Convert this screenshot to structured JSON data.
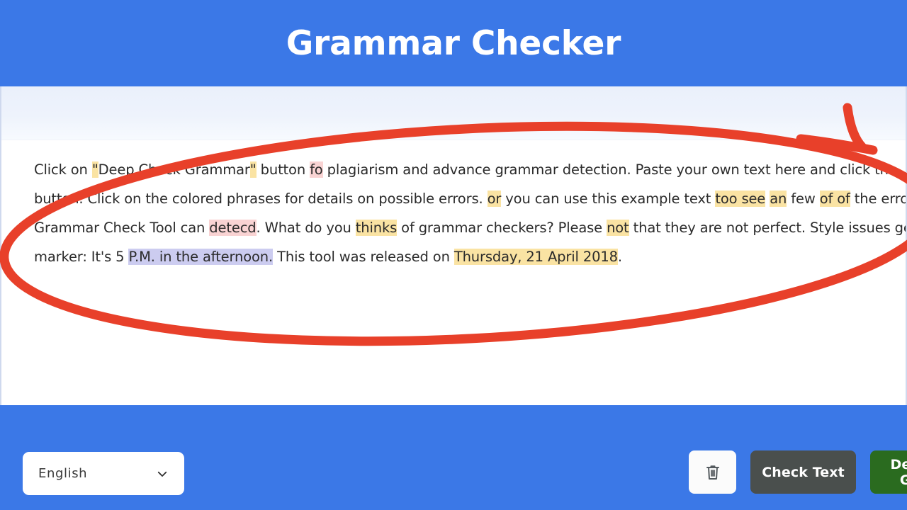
{
  "header": {
    "title": "Grammar Checker"
  },
  "editor": {
    "lines": [
      [
        {
          "text": "Click on ",
          "hl": "none"
        },
        {
          "text": "\"",
          "hl": "yellow"
        },
        {
          "text": "Deep Check Grammar",
          "hl": "none"
        },
        {
          "text": "\"",
          "hl": "yellow"
        },
        {
          "text": " button ",
          "hl": "none"
        },
        {
          "text": "fo",
          "hl": "red"
        },
        {
          "text": " plagiarism and advance grammar detection. Paste your own text here and click the",
          "hl": "none"
        }
      ],
      [
        {
          "text": "button. Click on the colored phrases for details on possible errors. ",
          "hl": "none"
        },
        {
          "text": "or",
          "hl": "yellow"
        },
        {
          "text": " you can use this example text ",
          "hl": "none"
        },
        {
          "text": "too see",
          "hl": "yellow"
        },
        {
          "text": " ",
          "hl": "none"
        },
        {
          "text": "an",
          "hl": "yellow"
        },
        {
          "text": " few ",
          "hl": "none"
        },
        {
          "text": "of of",
          "hl": "yellow"
        },
        {
          "text": " the errors that this",
          "hl": "none"
        }
      ],
      [
        {
          "text": "Grammar Check Tool can ",
          "hl": "none"
        },
        {
          "text": "detecd",
          "hl": "red"
        },
        {
          "text": ". What do you ",
          "hl": "none"
        },
        {
          "text": "thinks",
          "hl": "yellow"
        },
        {
          "text": " of grammar checkers? Please ",
          "hl": "none"
        },
        {
          "text": "not",
          "hl": "yellow"
        },
        {
          "text": " that they are not perfect. Style issues get a blue",
          "hl": "none"
        }
      ],
      [
        {
          "text": "marker: It's 5 ",
          "hl": "none"
        },
        {
          "text": "P.M. in the afternoon.",
          "hl": "purple"
        },
        {
          "text": " This tool was released on ",
          "hl": "none"
        },
        {
          "text": "Thursday, 21 April 2018",
          "hl": "yellow"
        },
        {
          "text": ".",
          "hl": "none"
        }
      ]
    ]
  },
  "footer": {
    "language": {
      "value": "English",
      "chevron_icon": "chevron-down-icon"
    },
    "clear_button": {
      "label": "",
      "icon": "trash-icon"
    },
    "check_button": {
      "label": "Check Text"
    },
    "deep_check_button": {
      "label": "Deep Check Grammar"
    }
  },
  "annotation": {
    "shape": "ellipse-with-arrow",
    "color": "#e8402a"
  },
  "colors": {
    "brand_blue": "#3b78e7",
    "toolbar_blue_gray": "#eaf0fb",
    "highlight_yellow": "#fae3a3",
    "highlight_red": "#f9d3d3",
    "highlight_purple": "#ccccf0",
    "check_button_gray": "#4a4f4d",
    "deep_button_green": "#2a6b1f",
    "annotation_red": "#e8402a"
  }
}
